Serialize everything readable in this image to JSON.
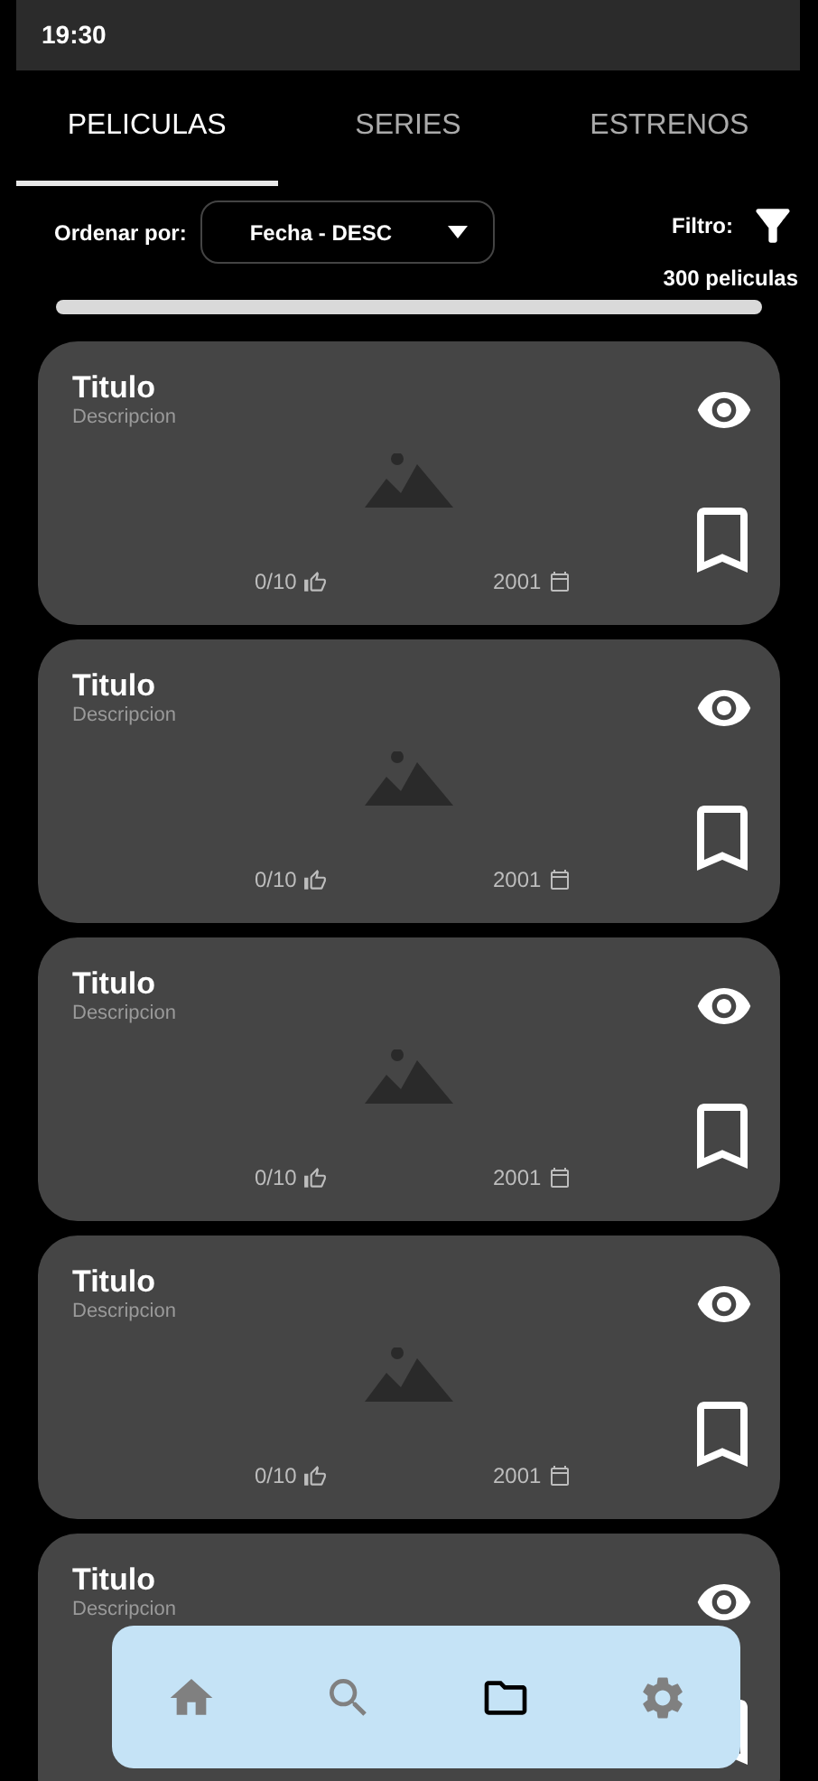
{
  "status_bar": {
    "time": "19:30"
  },
  "tabs": [
    {
      "label": "PELICULAS",
      "selected": true
    },
    {
      "label": "SERIES",
      "selected": false
    },
    {
      "label": "ESTRENOS",
      "selected": false
    }
  ],
  "sort": {
    "label": "Ordenar por:",
    "value": "Fecha - DESC"
  },
  "filter": {
    "label": "Filtro:",
    "count": "300 peliculas"
  },
  "cards": [
    {
      "title": "Titulo",
      "description": "Descripcion",
      "rating": "0/10",
      "year": "2001"
    },
    {
      "title": "Titulo",
      "description": "Descripcion",
      "rating": "0/10",
      "year": "2001"
    },
    {
      "title": "Titulo",
      "description": "Descripcion",
      "rating": "0/10",
      "year": "2001"
    },
    {
      "title": "Titulo",
      "description": "Descripcion",
      "rating": "0/10",
      "year": "2001"
    },
    {
      "title": "Titulo",
      "description": "Descripcion"
    }
  ],
  "bottom_nav": [
    {
      "kind": "home",
      "selected": false
    },
    {
      "kind": "search",
      "selected": false
    },
    {
      "kind": "folder",
      "selected": true
    },
    {
      "kind": "settings",
      "selected": false
    }
  ]
}
